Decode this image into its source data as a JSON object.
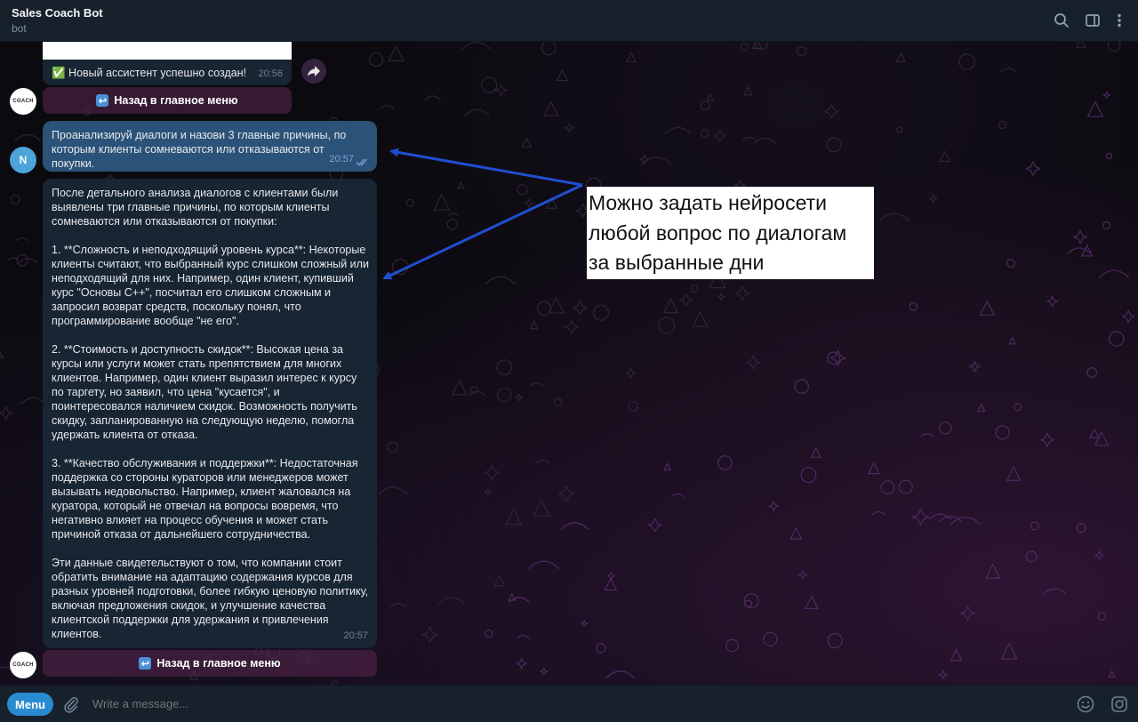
{
  "header": {
    "title": "Sales Coach Bot",
    "subtitle": "bot",
    "icons": [
      "search-icon",
      "sidebar-toggle-icon",
      "more-vertical-icon"
    ]
  },
  "messages": {
    "m1": {
      "text": "✅ Новый ассистент успешно создан!",
      "time": "20:56",
      "button": "Назад в главное меню"
    },
    "m2": {
      "text": "Проанализируй диалоги и назови 3 главные причины, по которым клиенты сомневаются или отказываются от покупки.",
      "time": "20:57",
      "avatar_letter": "N"
    },
    "m3": {
      "p1": "После детального анализа диалогов с клиентами были выявлены три главные причины, по которым клиенты сомневаются или отказываются от покупки:",
      "p2": "1. **Сложность и неподходящий уровень курса**: Некоторые клиенты считают, что выбранный курс слишком сложный или неподходящий для них. Например, один клиент, купивший курс \"Основы С++\", посчитал его слишком сложным и запросил возврат средств, поскольку понял, что программирование вообще \"не его\".",
      "p3": "2. **Стоимость и доступность скидок**: Высокая цена за курсы или услуги может стать препятствием для многих клиентов. Например, один клиент выразил интерес к курсу по таргету, но заявил, что цена \"кусается\", и поинтересовался наличием скидок. Возможность получить скидку, запланированную на следующую неделю, помогла удержать клиента от отказа.",
      "p4": "3. **Качество обслуживания и поддержки**: Недостаточная поддержка со стороны кураторов или менеджеров может вызывать недовольство. Например, клиент жаловался на куратора, который не отвечал на вопросы вовремя, что негативно влияет на процесс обучения и может стать причиной отказа от дальнейшего сотрудничества.",
      "p5": "Эти данные свидетельствуют о том, что компании стоит обратить внимание на адаптацию содержания курсов для разных уровней подготовки, более гибкую ценовую политику, включая предложения скидок, и улучшение качества клиентской поддержки для удержания и привлечения клиентов.",
      "time": "20:57",
      "button": "Назад в главное меню"
    }
  },
  "bot_avatar_text": "COACH",
  "callout": "Можно задать нейросети любой вопрос по диалогам за выбранные дни",
  "composer": {
    "menu_label": "Menu",
    "placeholder": "Write a message..."
  },
  "colors": {
    "header_bg": "#17212b",
    "incoming_bubble": "#182533",
    "outgoing_bubble": "#2b5278",
    "arrow": "#1f4fd1",
    "menu_button": "#2b8bd1"
  }
}
